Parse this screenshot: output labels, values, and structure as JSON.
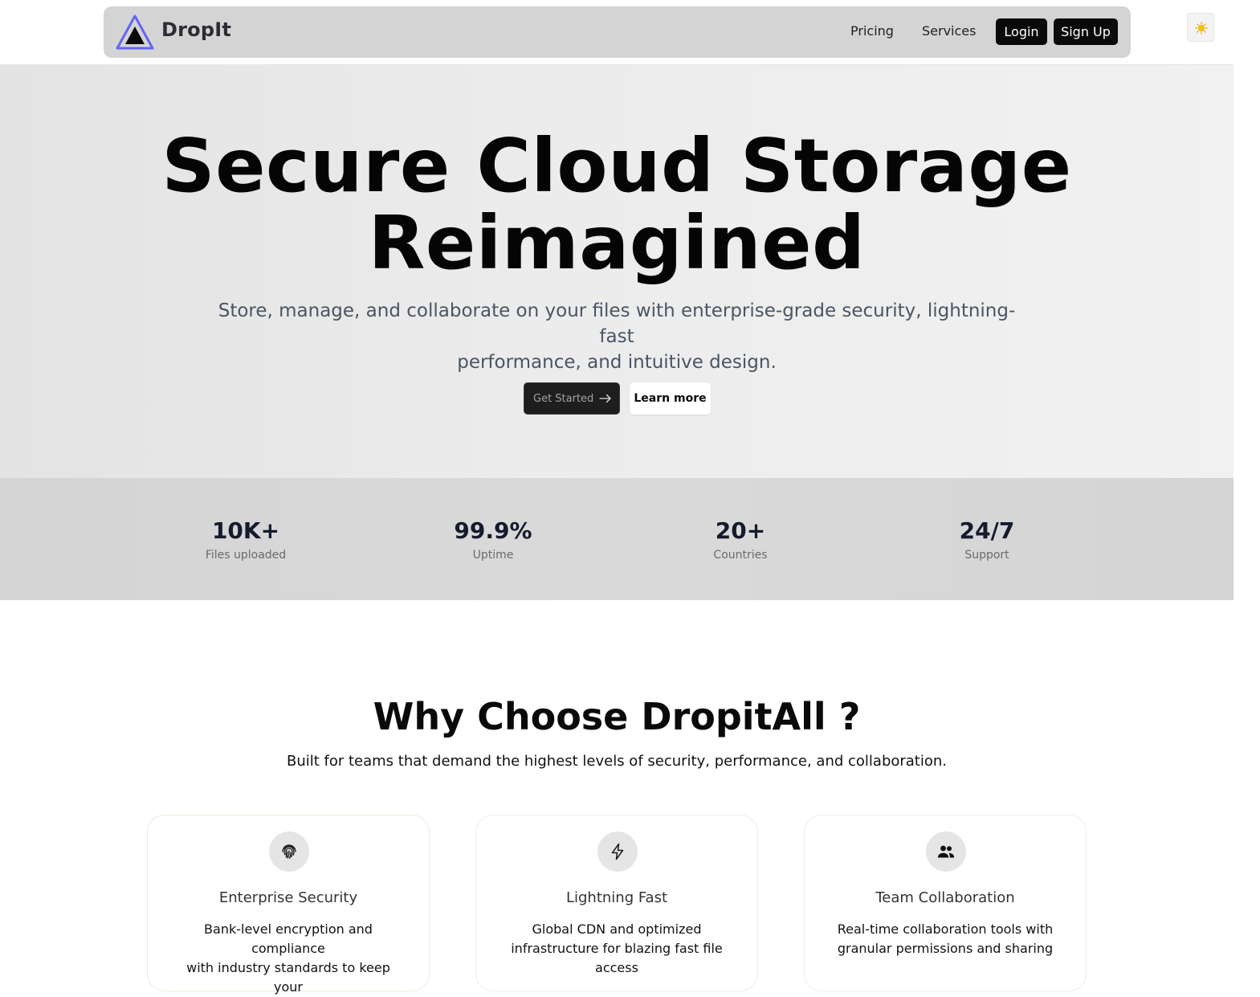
{
  "header": {
    "brand": "DropIt",
    "nav": {
      "pricing": "Pricing",
      "services": "Services"
    },
    "login_label": "Login",
    "signup_label": "Sign Up",
    "theme_toggle_icon": "sun-icon",
    "logo_icon": "triangle-logo-icon",
    "accent_color": "#6366f1"
  },
  "hero": {
    "title_line1": "Secure Cloud Storage",
    "title_line2": "Reimagined",
    "subtitle_line1": "Store, manage, and collaborate on your files with enterprise-grade security, lightning-fast",
    "subtitle_line2": "performance, and intuitive design.",
    "get_started_label": "Get Started",
    "get_started_icon": "arrow-right-icon",
    "learn_more_label": "Learn more"
  },
  "stats": [
    {
      "value": "10K+",
      "label": "Files uploaded"
    },
    {
      "value": "99.9%",
      "label": "Uptime"
    },
    {
      "value": "20+",
      "label": "Countries"
    },
    {
      "value": "24/7",
      "label": "Support"
    }
  ],
  "why": {
    "title": "Why Choose DropitAll ?",
    "subtitle": "Built for teams that demand the highest levels of security, performance, and collaboration.",
    "features": [
      {
        "icon": "fingerprint-icon",
        "title": "Enterprise Security",
        "desc_line1": "Bank-level encryption and compliance",
        "desc_line2": "with industry standards to keep your"
      },
      {
        "icon": "lightning-icon",
        "title": "Lightning Fast",
        "desc_line1": "Global CDN and optimized",
        "desc_line2": "infrastructure for blazing fast file access"
      },
      {
        "icon": "users-icon",
        "title": "Team Collaboration",
        "desc_line1": "Real-time collaboration tools with",
        "desc_line2": "granular permissions and sharing"
      }
    ]
  }
}
